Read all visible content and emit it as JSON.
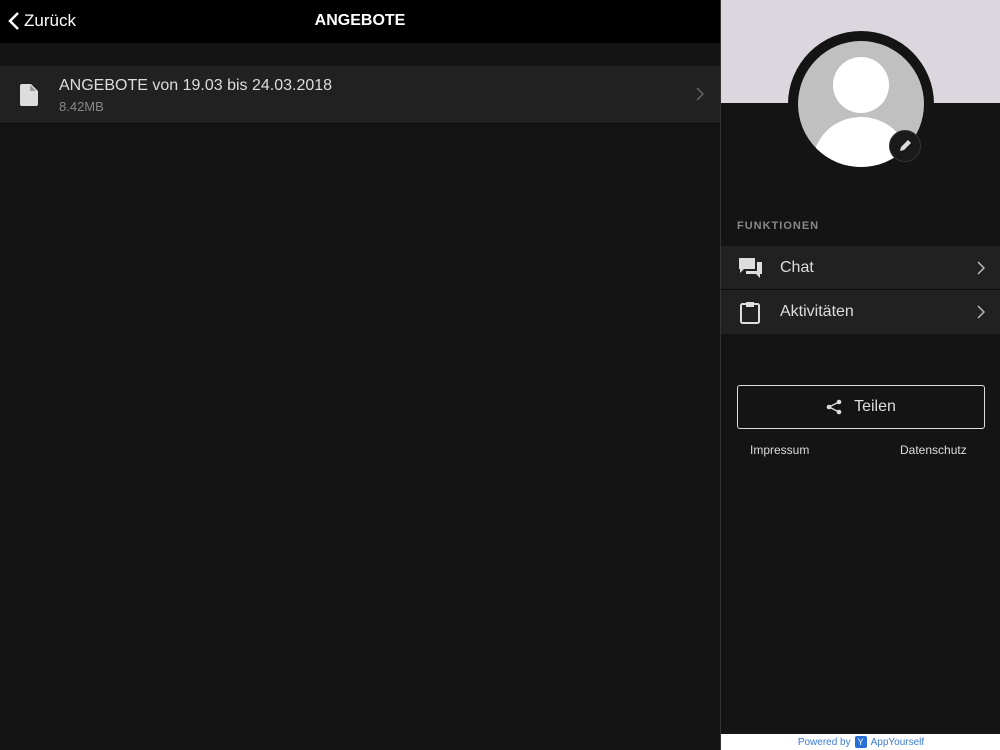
{
  "header": {
    "back_label": "Zurück",
    "title": "ANGEBOTE"
  },
  "files": [
    {
      "name": "ANGEBOTE von 19.03 bis 24.03.2018",
      "size": "8.42MB"
    }
  ],
  "sidebar": {
    "section_title": "FUNKTIONEN",
    "items": [
      {
        "label": "Chat"
      },
      {
        "label": "Aktivitäten"
      }
    ],
    "share_label": "Teilen",
    "impressum": "Impressum",
    "datenschutz": "Datenschutz",
    "powered_by": "Powered by",
    "brand": "AppYourself"
  }
}
